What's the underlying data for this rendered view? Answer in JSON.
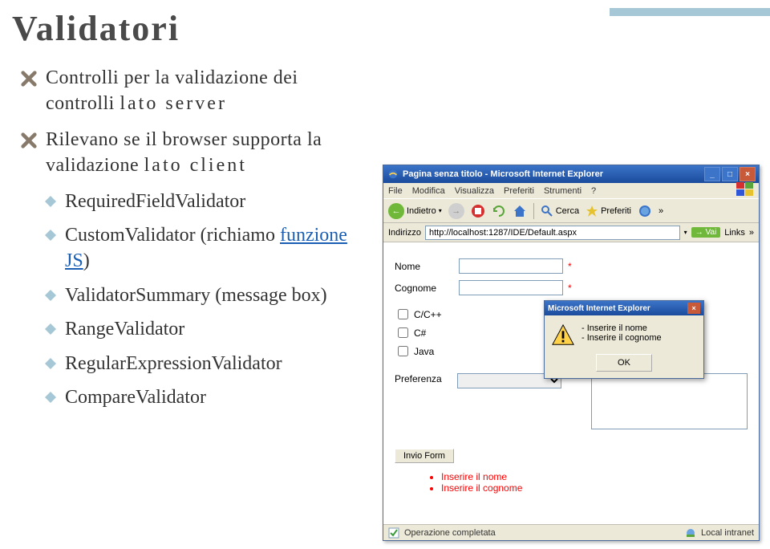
{
  "title": "Validatori",
  "bullet1_pre": "Controlli per la validazione dei controlli ",
  "bullet1_kw": "lato server",
  "bullet2_pre": "Rilevano se il browser supporta la validazione ",
  "bullet2_kw": "lato client",
  "items": {
    "required": "RequiredFieldValidator",
    "custom_pre": "CustomValidator (richiamo ",
    "custom_link": "funzione JS",
    "custom_post": ")",
    "summary": "ValidatorSummary (message box)",
    "range": "RangeValidator",
    "regex": "RegularExpressionValidator",
    "compare": "CompareValidator"
  },
  "ie": {
    "title": "Pagina senza titolo - Microsoft Internet Explorer",
    "menu": {
      "file": "File",
      "edit": "Modifica",
      "view": "Visualizza",
      "fav": "Preferiti",
      "tools": "Strumenti",
      "help": "?"
    },
    "toolbar": {
      "back": "Indietro",
      "search": "Cerca",
      "fav": "Preferiti"
    },
    "addr_lbl": "Indirizzo",
    "url": "http://localhost:1287/IDE/Default.aspx",
    "go": "Vai",
    "links": "Links",
    "form": {
      "nome_lbl": "Nome",
      "nome_val": "",
      "cognome_lbl": "Cognome",
      "cognome_val": "",
      "asterisk": "*",
      "chk1": "C/C++",
      "chk2": "C#",
      "chk3": "Java",
      "pref_lbl": "Preferenza",
      "pref_val": "",
      "submit": "Invio Form"
    },
    "errors": [
      "Inserire il nome",
      "Inserire il cognome"
    ],
    "msgbox": {
      "title": "Microsoft Internet Explorer",
      "line1": "- Inserire il nome",
      "line2": "- Inserire il cognome",
      "ok": "OK"
    },
    "status_left": "Operazione completata",
    "status_right": "Local intranet"
  }
}
